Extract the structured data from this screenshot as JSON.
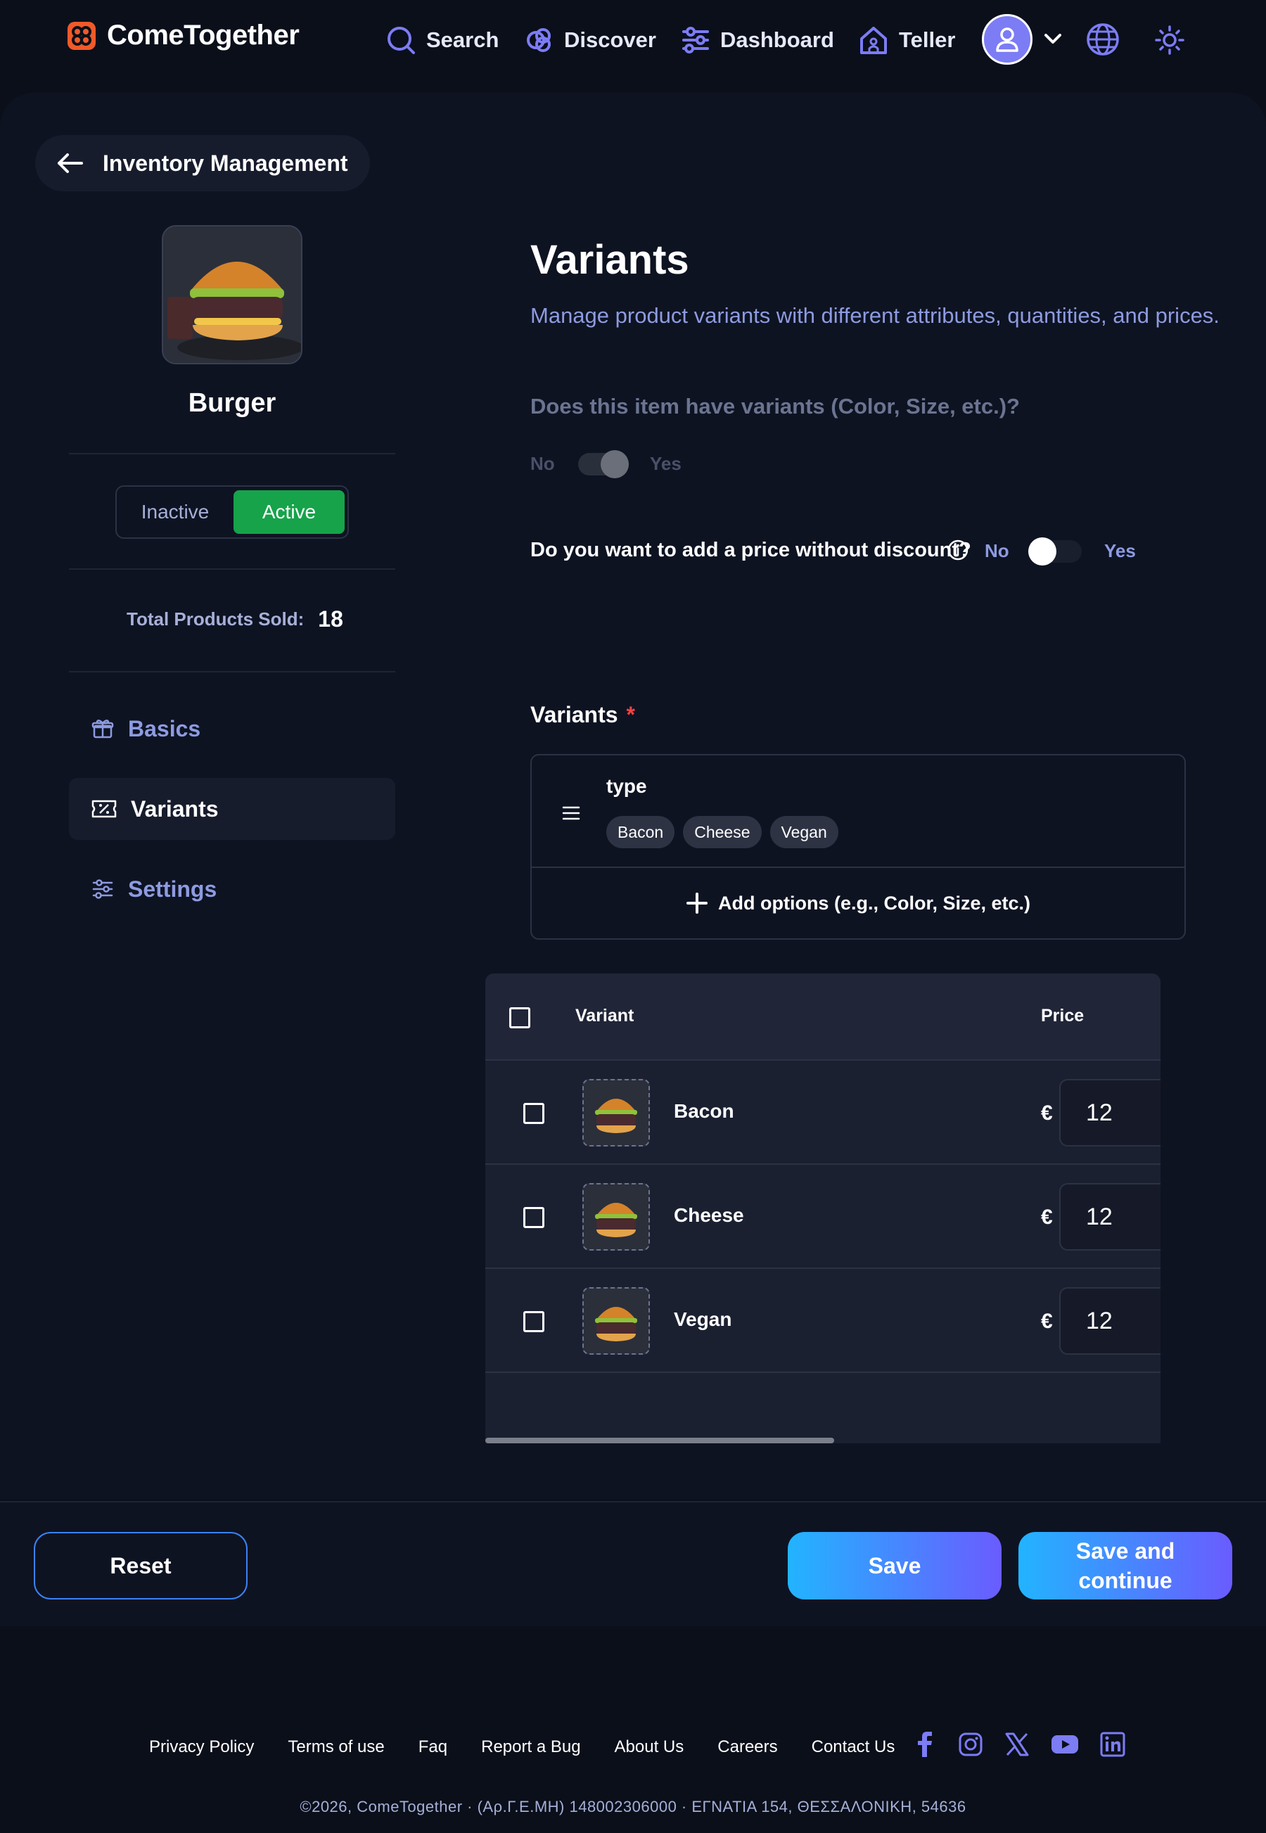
{
  "header": {
    "brand": "ComeTogether",
    "nav": [
      {
        "label": "Search",
        "icon": "search-icon"
      },
      {
        "label": "Discover",
        "icon": "discover-icon"
      },
      {
        "label": "Dashboard",
        "icon": "sliders-icon"
      },
      {
        "label": "Teller",
        "icon": "home-icon"
      }
    ],
    "accent_color": "#7c7cf5"
  },
  "sidebar": {
    "back_label": "Inventory Management",
    "product_name": "Burger",
    "status": {
      "inactive": "Inactive",
      "active": "Active",
      "selected": "Active",
      "active_color": "#16a34a"
    },
    "total_sold_label": "Total Products Sold:",
    "total_sold_value": "18",
    "items": [
      {
        "label": "Basics",
        "icon": "gift-icon",
        "active": false
      },
      {
        "label": "Variants",
        "icon": "ticket-percent-icon",
        "active": true
      },
      {
        "label": "Settings",
        "icon": "sliders-icon",
        "active": false
      }
    ]
  },
  "content": {
    "title": "Variants",
    "subtitle": "Manage product variants with different attributes, quantities, and prices.",
    "has_variants_question": "Does this item have variants (Color, Size, etc.)?",
    "has_variants_no": "No",
    "has_variants_yes": "Yes",
    "has_variants_value": true,
    "discount_question": "Do you want to add a price without discount?",
    "discount_no": "No",
    "discount_yes": "Yes",
    "discount_value": false,
    "variants_heading": "Variants",
    "required_mark": "*",
    "option_group": {
      "name": "type",
      "values": [
        "Bacon",
        "Cheese",
        "Vegan"
      ]
    },
    "add_options_label": "Add options (e.g., Color, Size, etc.)"
  },
  "table": {
    "columns": [
      "Variant",
      "Price"
    ],
    "currency": "€",
    "rows": [
      {
        "name": "Bacon",
        "price": "12"
      },
      {
        "name": "Cheese",
        "price": "12"
      },
      {
        "name": "Vegan",
        "price": "12"
      }
    ]
  },
  "actions": {
    "reset": "Reset",
    "save": "Save",
    "save_continue": "Save and continue"
  },
  "footer": {
    "links": [
      "Privacy Policy",
      "Terms of use",
      "Faq",
      "Report a Bug",
      "About Us",
      "Careers",
      "Contact Us"
    ],
    "socials": [
      "facebook-icon",
      "instagram-icon",
      "x-icon",
      "youtube-icon",
      "linkedin-icon"
    ],
    "copyright": "©2026, ComeTogether · (Αρ.Γ.Ε.ΜΗ) 148002306000 · ΕΓΝΑΤΙΑ 154, ΘΕΣΣΑΛΟΝΙΚΗ, 54636"
  }
}
